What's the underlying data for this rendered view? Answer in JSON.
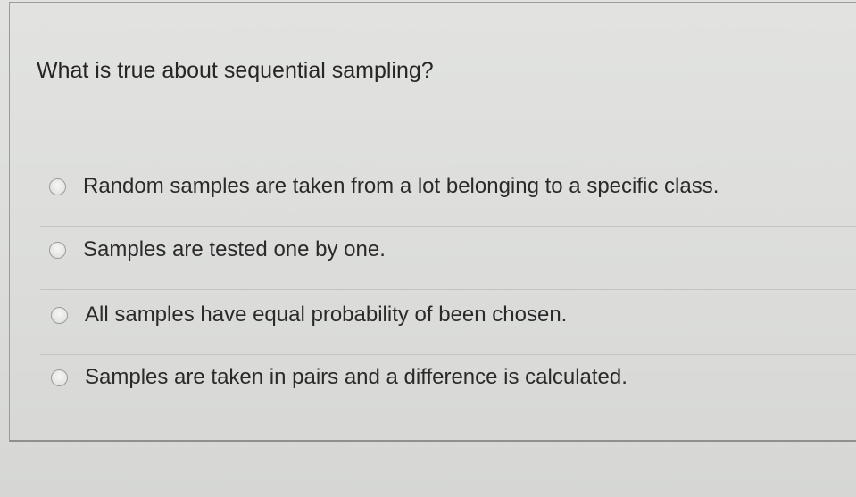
{
  "question": {
    "text": "What is true about sequential sampling?"
  },
  "options": [
    {
      "label": "Random samples are taken from a lot belonging to a specific class.",
      "selected": false
    },
    {
      "label": "Samples are tested one by one.",
      "selected": false
    },
    {
      "label": "All samples have equal probability of been chosen.",
      "selected": false
    },
    {
      "label": "Samples are taken in pairs and a difference is calculated.",
      "selected": false
    }
  ],
  "colors": {
    "background": "#d9dad7",
    "text": "#262626",
    "border": "#9b9c99"
  }
}
